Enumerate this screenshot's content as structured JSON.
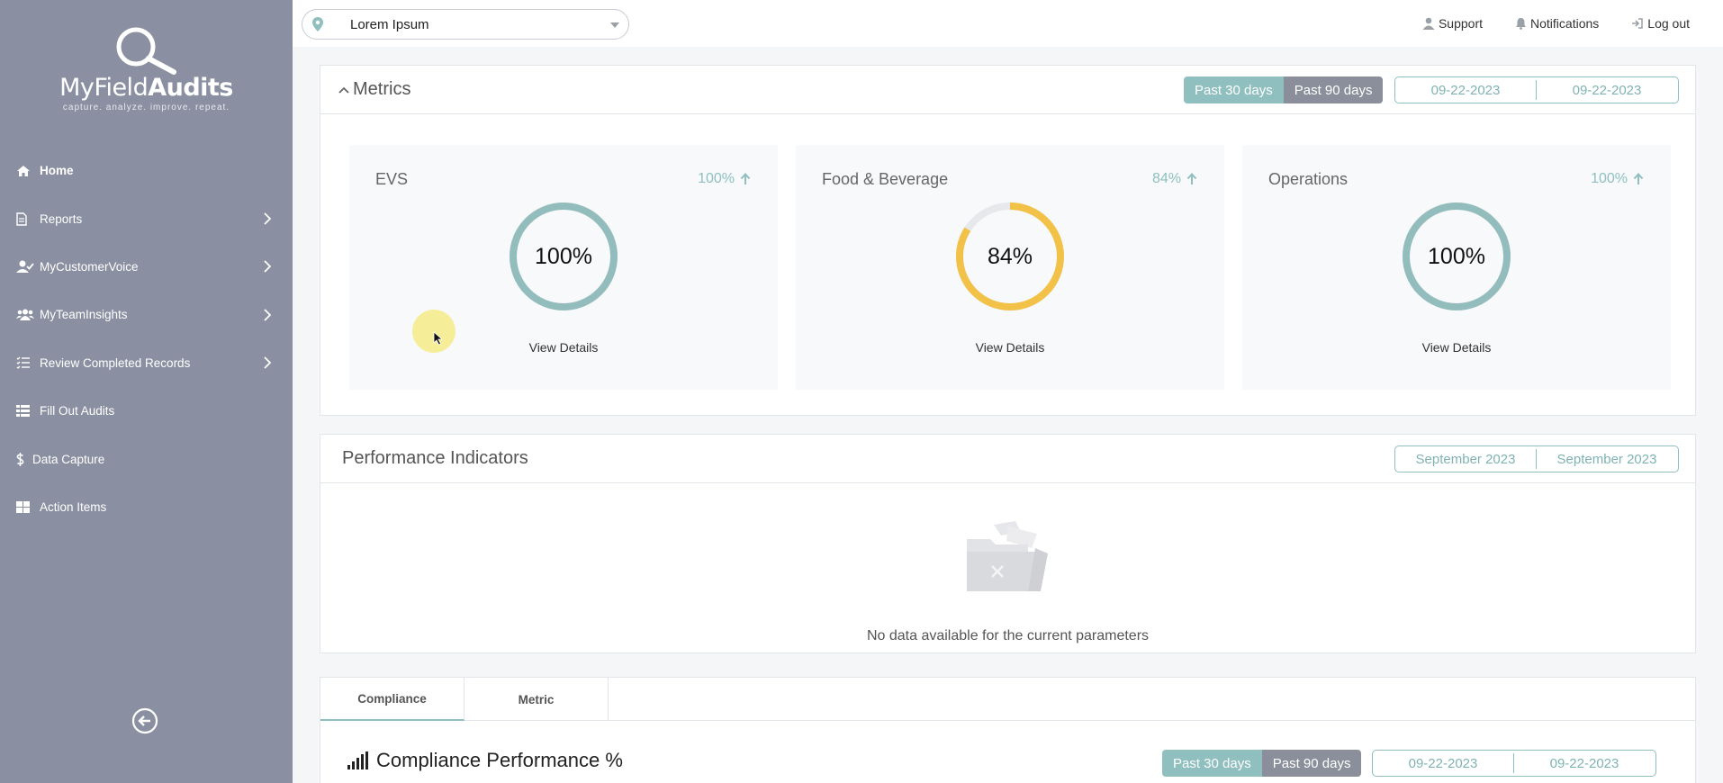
{
  "brand": {
    "name_light": "MyField",
    "name_bold": "Audits",
    "tagline": "capture. analyze. improve. repeat."
  },
  "sidebar": {
    "items": [
      {
        "label": "Home",
        "icon": "home-icon",
        "has_submenu": false
      },
      {
        "label": "Reports",
        "icon": "document-icon",
        "has_submenu": true
      },
      {
        "label": "MyCustomerVoice",
        "icon": "user-check-icon",
        "has_submenu": true
      },
      {
        "label": "MyTeamInsights",
        "icon": "users-icon",
        "has_submenu": true
      },
      {
        "label": "Review Completed Records",
        "icon": "list-check-icon",
        "has_submenu": true
      },
      {
        "label": "Fill Out Audits",
        "icon": "table-icon",
        "has_submenu": false
      },
      {
        "label": "Data Capture",
        "icon": "dollar-icon",
        "has_submenu": false
      },
      {
        "label": "Action Items",
        "icon": "grid-icon",
        "has_submenu": false
      }
    ],
    "collapse_icon": "arrow-left-circle-icon"
  },
  "topbar": {
    "location_value": "Lorem Ipsum",
    "support_label": "Support",
    "notifications_label": "Notifications",
    "logout_label": "Log out"
  },
  "metrics": {
    "title": "Metrics",
    "range_30": "Past 30 days",
    "range_90": "Past 90 days",
    "date_from": "09-22-2023",
    "date_to": "09-22-2023",
    "cards": [
      {
        "title": "EVS",
        "change": "100%",
        "value_label": "100%",
        "value": 100,
        "color": "#93bdbd",
        "link": "View Details"
      },
      {
        "title": "Food & Beverage",
        "change": "84%",
        "value_label": "84%",
        "value": 84,
        "color": "#f2c148",
        "link": "View Details"
      },
      {
        "title": "Operations",
        "change": "100%",
        "value_label": "100%",
        "value": 100,
        "color": "#93bdbd",
        "link": "View Details"
      }
    ]
  },
  "performance": {
    "title": "Performance Indicators",
    "month_from": "September 2023",
    "month_to": "September 2023",
    "empty_text": "No data available for the current parameters"
  },
  "compliance": {
    "tabs": [
      "Compliance",
      "Metric"
    ],
    "active_tab": "Compliance",
    "title": "Compliance Performance %",
    "range_30": "Past 30 days",
    "range_90": "Past 90 days",
    "date_from": "09-22-2023",
    "date_to": "09-22-2023"
  },
  "colors": {
    "sidebar_bg": "#8a90a2",
    "accent_teal": "#8fbfbe",
    "accent_gray": "#8a8f9b",
    "donut_yellow": "#f2c148"
  }
}
